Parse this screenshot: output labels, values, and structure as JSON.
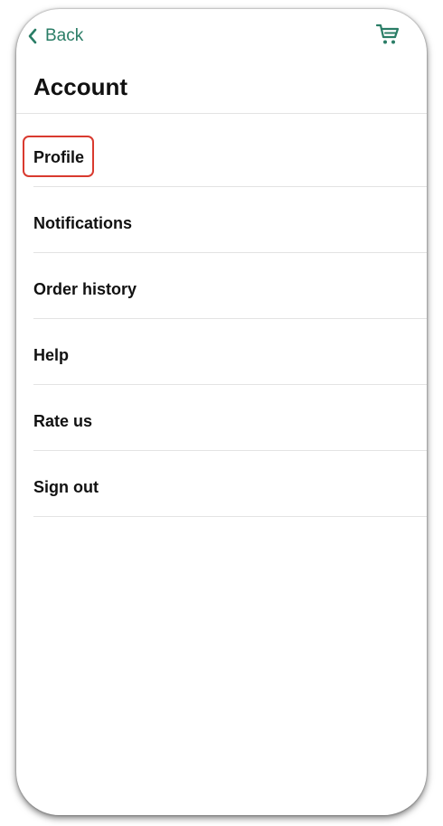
{
  "header": {
    "back_label": "Back",
    "back_icon": "chevron-left-icon",
    "cart_icon": "cart-icon"
  },
  "page": {
    "title": "Account"
  },
  "menu": {
    "items": [
      {
        "label": "Profile",
        "highlighted": true
      },
      {
        "label": "Notifications"
      },
      {
        "label": "Order history"
      },
      {
        "label": "Help"
      },
      {
        "label": "Rate us"
      },
      {
        "label": "Sign out"
      }
    ]
  },
  "colors": {
    "accent": "#2a7d66",
    "highlight": "#d93a2f",
    "divider": "#e3e3e3",
    "text": "#111111"
  }
}
